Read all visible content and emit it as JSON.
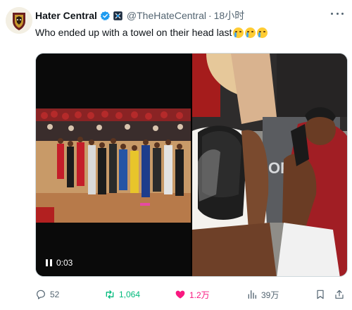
{
  "tweet": {
    "display_name": "Hater Central",
    "handle": "@TheHateCentral",
    "separator": "·",
    "time": "18小时",
    "text": "Who ended up with a towel on their head last",
    "emoji_count": 3
  },
  "video": {
    "timestamp": "0:03",
    "state": "playing"
  },
  "actions": {
    "replies": "52",
    "retweets": "1,064",
    "likes": "1.2万",
    "views": "39万"
  },
  "colors": {
    "accent_verified": "#1d9bf0",
    "retweet_green": "#00ba7c",
    "like_pink": "#f91880",
    "muted": "#536471"
  },
  "icons": [
    "verified-badge-icon",
    "affiliate-badge-icon",
    "more-icon",
    "reply-icon",
    "retweet-icon",
    "like-icon",
    "views-icon",
    "bookmark-icon",
    "share-icon",
    "pause-icon"
  ]
}
